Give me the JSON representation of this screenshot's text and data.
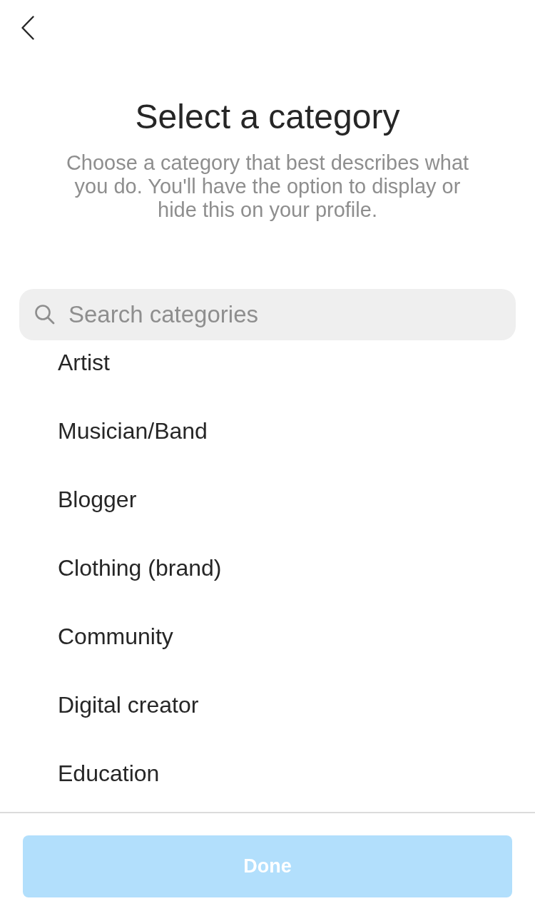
{
  "title": "Select a category",
  "description": "Choose a category that best describes what you do. You'll have the option to display or hide this on your profile.",
  "search": {
    "placeholder": "Search categories"
  },
  "categories": [
    {
      "label": "Artist",
      "selected": false
    },
    {
      "label": "Musician/Band",
      "selected": false
    },
    {
      "label": "Blogger",
      "selected": false
    },
    {
      "label": "Clothing (brand)",
      "selected": false
    },
    {
      "label": "Community",
      "selected": false
    },
    {
      "label": "Digital creator",
      "selected": false
    },
    {
      "label": "Education",
      "selected": false
    }
  ],
  "done_button": {
    "label": "Done",
    "disabled": true
  }
}
